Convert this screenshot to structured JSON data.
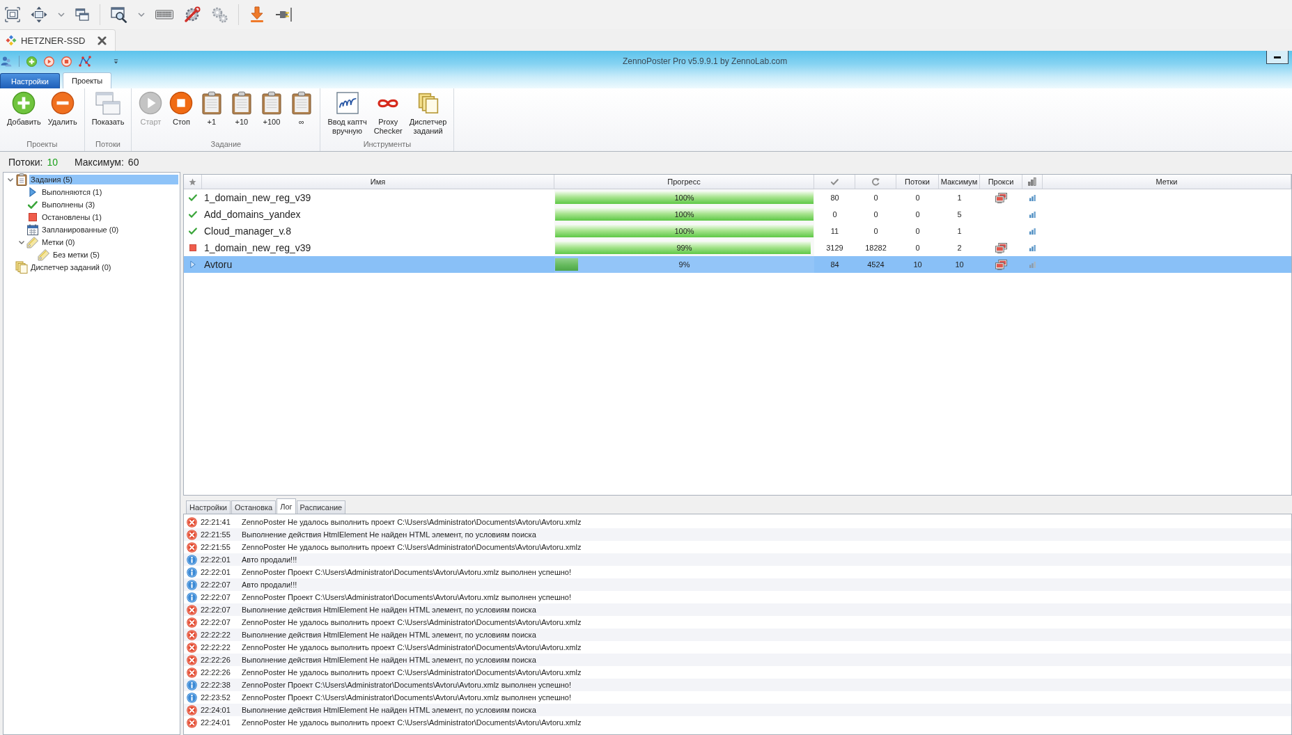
{
  "session_tab": {
    "title": "HETZNER-SSD"
  },
  "window": {
    "title": "ZennoPoster Pro v5.9.9.1 by ZennoLab.com"
  },
  "ribbon_tabs": [
    {
      "label": "Настройки",
      "kind": "menu",
      "selected": false
    },
    {
      "label": "Проекты",
      "kind": "tab",
      "selected": true
    }
  ],
  "ribbon_groups": [
    {
      "label": "Проекты",
      "buttons": [
        {
          "label": "Добавить",
          "kind": "add",
          "disabled": false
        },
        {
          "label": "Удалить",
          "kind": "remove",
          "disabled": false
        }
      ]
    },
    {
      "label": "Потоки",
      "buttons": [
        {
          "label": "Показать",
          "kind": "windows",
          "disabled": false
        }
      ]
    },
    {
      "label": "Задание",
      "buttons": [
        {
          "label": "Старт",
          "kind": "start",
          "disabled": true
        },
        {
          "label": "Стоп",
          "kind": "stop",
          "disabled": false
        },
        {
          "label": "+1",
          "kind": "clipboard",
          "disabled": false
        },
        {
          "label": "+10",
          "kind": "clipboard",
          "disabled": false
        },
        {
          "label": "+100",
          "kind": "clipboard",
          "disabled": false
        },
        {
          "label": "∞",
          "kind": "clipboard",
          "disabled": false
        }
      ]
    },
    {
      "label": "Инструменты",
      "buttons": [
        {
          "label": "Ввод каптч\nвручную",
          "kind": "captcha",
          "disabled": false
        },
        {
          "label": "Proxy\nChecker",
          "kind": "infinity",
          "disabled": false
        },
        {
          "label": "Диспетчер\nзаданий",
          "kind": "documents",
          "disabled": false
        }
      ]
    }
  ],
  "status_line": {
    "threads_label": "Потоки:",
    "threads": "10",
    "maximum_label": "Максимум:",
    "maximum": "60"
  },
  "tree": [
    {
      "label": "Задания (5)",
      "kind": "tasks",
      "selected": true,
      "expanded": true,
      "children": [
        {
          "label": "Выполняются (1)",
          "kind": "running",
          "selected": false
        },
        {
          "label": "Выполнены (3)",
          "kind": "done",
          "selected": false
        },
        {
          "label": "Остановлены (1)",
          "kind": "stopped",
          "selected": false
        },
        {
          "label": "Запланированные (0)",
          "kind": "scheduled",
          "selected": false
        },
        {
          "label": "Метки (0)",
          "kind": "tag",
          "selected": false,
          "expanded": true,
          "children": [
            {
              "label": "Без метки (5)",
              "kind": "tag",
              "selected": false
            }
          ]
        }
      ]
    },
    {
      "label": "Диспетчер заданий (0)",
      "kind": "dispatcher",
      "selected": false
    }
  ],
  "table": {
    "headers": {
      "name": "Имя",
      "progress": "Прогресс",
      "threads": "Потоки",
      "maximum": "Максимум",
      "proxy": "Прокси",
      "tags": "Метки"
    },
    "rows": [
      {
        "kind": "done",
        "name": "1_domain_new_reg_v39",
        "level": 1,
        "progress": "100%",
        "check_count": "80",
        "refresh_count": "0",
        "threads": "0",
        "maximum": "1",
        "proxy": true,
        "selected": false
      },
      {
        "kind": "done",
        "name": "Add_domains_yandex",
        "level": 1,
        "progress": "100%",
        "check_count": "0",
        "refresh_count": "0",
        "threads": "0",
        "maximum": "5",
        "proxy": false,
        "selected": false
      },
      {
        "kind": "done",
        "name": "Cloud_manager_v.8",
        "level": 1,
        "progress": "100%",
        "check_count": "11",
        "refresh_count": "0",
        "threads": "0",
        "maximum": "1",
        "proxy": false,
        "selected": false
      },
      {
        "kind": "stopped",
        "name": "1_domain_new_reg_v39",
        "level": 0.99,
        "progress": "99%",
        "check_count": "3129",
        "refresh_count": "18282",
        "threads": "0",
        "maximum": "2",
        "proxy": true,
        "selected": false
      },
      {
        "kind": "running",
        "name": "Avtoru",
        "level": 0.09,
        "progress": "9%",
        "check_count": "84",
        "refresh_count": "4524",
        "threads": "10",
        "maximum": "10",
        "proxy": true,
        "selected": true
      }
    ]
  },
  "bottom_tabs": [
    {
      "label": "Настройки",
      "selected": false
    },
    {
      "label": "Остановка",
      "selected": false
    },
    {
      "label": "Лог",
      "selected": true
    },
    {
      "label": "Расписание",
      "selected": false
    }
  ],
  "log": [
    {
      "kind": "error",
      "time": "22:21:41",
      "message": "ZennoPoster Не удалось выполнить проект C:\\Users\\Administrator\\Documents\\Avtoru\\Avtoru.xmlz"
    },
    {
      "kind": "error",
      "time": "22:21:55",
      "message": "Выполнение действия HtmlElement Не найден HTML элемент, по условиям поиска"
    },
    {
      "kind": "error",
      "time": "22:21:55",
      "message": "ZennoPoster Не удалось выполнить проект C:\\Users\\Administrator\\Documents\\Avtoru\\Avtoru.xmlz"
    },
    {
      "kind": "info",
      "time": "22:22:01",
      "message": "Авто продали!!!"
    },
    {
      "kind": "info",
      "time": "22:22:01",
      "message": "ZennoPoster Проект C:\\Users\\Administrator\\Documents\\Avtoru\\Avtoru.xmlz выполнен успешно!"
    },
    {
      "kind": "info",
      "time": "22:22:07",
      "message": "Авто продали!!!"
    },
    {
      "kind": "info",
      "time": "22:22:07",
      "message": "ZennoPoster Проект C:\\Users\\Administrator\\Documents\\Avtoru\\Avtoru.xmlz выполнен успешно!"
    },
    {
      "kind": "error",
      "time": "22:22:07",
      "message": "Выполнение действия HtmlElement Не найден HTML элемент, по условиям поиска"
    },
    {
      "kind": "error",
      "time": "22:22:07",
      "message": "ZennoPoster Не удалось выполнить проект C:\\Users\\Administrator\\Documents\\Avtoru\\Avtoru.xmlz"
    },
    {
      "kind": "error",
      "time": "22:22:22",
      "message": "Выполнение действия HtmlElement Не найден HTML элемент, по условиям поиска"
    },
    {
      "kind": "error",
      "time": "22:22:22",
      "message": "ZennoPoster Не удалось выполнить проект C:\\Users\\Administrator\\Documents\\Avtoru\\Avtoru.xmlz"
    },
    {
      "kind": "error",
      "time": "22:22:26",
      "message": "Выполнение действия HtmlElement Не найден HTML элемент, по условиям поиска"
    },
    {
      "kind": "error",
      "time": "22:22:26",
      "message": "ZennoPoster Не удалось выполнить проект C:\\Users\\Administrator\\Documents\\Avtoru\\Avtoru.xmlz"
    },
    {
      "kind": "info",
      "time": "22:22:38",
      "message": "ZennoPoster Проект C:\\Users\\Administrator\\Documents\\Avtoru\\Avtoru.xmlz выполнен успешно!"
    },
    {
      "kind": "info",
      "time": "22:23:52",
      "message": "ZennoPoster Проект C:\\Users\\Administrator\\Documents\\Avtoru\\Avtoru.xmlz выполнен успешно!"
    },
    {
      "kind": "error",
      "time": "22:24:01",
      "message": "Выполнение действия HtmlElement Не найден HTML элемент, по условиям поиска"
    },
    {
      "kind": "error",
      "time": "22:24:01",
      "message": "ZennoPoster Не удалось выполнить проект C:\\Users\\Administrator\\Documents\\Avtoru\\Avtoru.xmlz"
    }
  ]
}
